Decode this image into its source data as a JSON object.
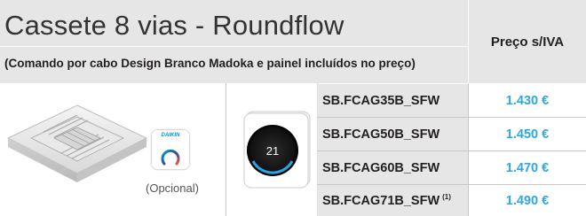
{
  "header": {
    "title": "Cassete 8 vias - Roundflow",
    "subtitle": "(Comando por cabo Design Branco Madoka e painel incluídos no preço)",
    "price_header": "Preço s/IVA"
  },
  "product": {
    "optional_label": "(Opcional)",
    "badge_brand": "DAIKIN",
    "controller_display": "21"
  },
  "rows": [
    {
      "model": "SB.FCAG35B_SFW",
      "note": "",
      "price": "1.430 €"
    },
    {
      "model": "SB.FCAG50B_SFW",
      "note": "",
      "price": "1.450 €"
    },
    {
      "model": "SB.FCAG60B_SFW",
      "note": "",
      "price": "1.470 €"
    },
    {
      "model": "SB.FCAG71B_SFW",
      "note": "(1)",
      "price": "1.490 €"
    }
  ],
  "colors": {
    "header_bg": "#e6e6e6",
    "price_text": "#2da8e1",
    "brand_blue": "#0097d7"
  }
}
